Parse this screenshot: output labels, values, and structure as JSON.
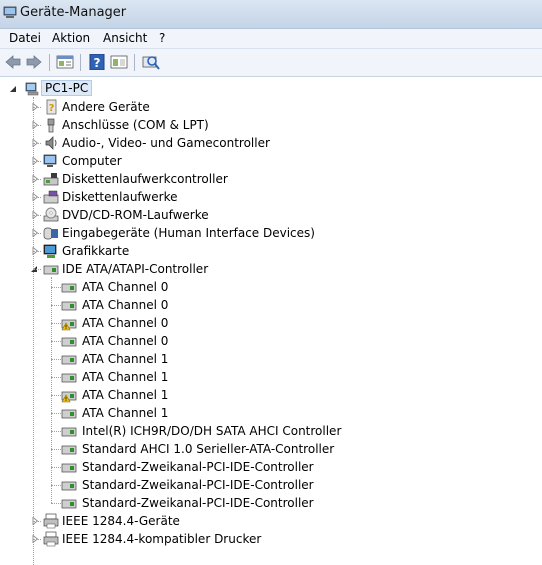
{
  "window": {
    "title": "Geräte-Manager"
  },
  "menu": {
    "items": [
      "Datei",
      "Aktion",
      "Ansicht",
      "?"
    ]
  },
  "toolbar": {
    "buttons": [
      "back-icon",
      "forward-icon",
      "properties-icon",
      "help-icon",
      "view-icon",
      "scan-hardware-icon"
    ]
  },
  "tree": {
    "root": "PC1-PC",
    "categories": [
      "Andere Geräte",
      "Anschlüsse (COM & LPT)",
      "Audio-, Video- und Gamecontroller",
      "Computer",
      "Diskettenlaufwerkcontroller",
      "Diskettenlaufwerke",
      "DVD/CD-ROM-Laufwerke",
      "Eingabegeräte (Human Interface Devices)",
      "Grafikkarte",
      "IDE ATA/ATAPI-Controller"
    ],
    "ide_children": [
      {
        "label": "ATA Channel 0",
        "warning": false
      },
      {
        "label": "ATA Channel 0",
        "warning": false
      },
      {
        "label": "ATA Channel 0",
        "warning": true
      },
      {
        "label": "ATA Channel 0",
        "warning": false
      },
      {
        "label": "ATA Channel 1",
        "warning": false
      },
      {
        "label": "ATA Channel 1",
        "warning": false
      },
      {
        "label": "ATA Channel 1",
        "warning": true
      },
      {
        "label": "ATA Channel 1",
        "warning": false
      },
      {
        "label": "Intel(R) ICH9R/DO/DH SATA AHCI Controller",
        "warning": false
      },
      {
        "label": "Standard AHCI 1.0 Serieller-ATA-Controller",
        "warning": false
      },
      {
        "label": "Standard-Zweikanal-PCI-IDE-Controller",
        "warning": false
      },
      {
        "label": "Standard-Zweikanal-PCI-IDE-Controller",
        "warning": false
      },
      {
        "label": "Standard-Zweikanal-PCI-IDE-Controller",
        "warning": false
      }
    ],
    "after": [
      "IEEE 1284.4-Geräte",
      "IEEE 1284.4-kompatibler Drucker"
    ]
  }
}
